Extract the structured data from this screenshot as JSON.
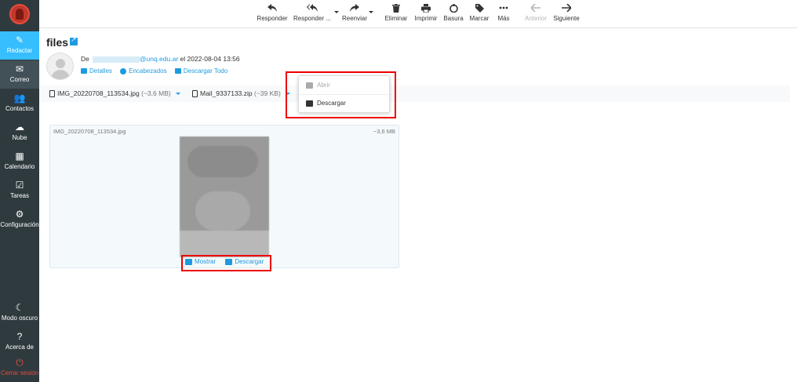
{
  "sidebar": {
    "items": [
      {
        "label": "Redactar",
        "icon": "compose-icon"
      },
      {
        "label": "Correo",
        "icon": "envelope-icon"
      },
      {
        "label": "Contactos",
        "icon": "contacts-icon"
      },
      {
        "label": "Nube",
        "icon": "cloud-icon"
      },
      {
        "label": "Calendario",
        "icon": "calendar-icon"
      },
      {
        "label": "Tareas",
        "icon": "tasks-icon"
      },
      {
        "label": "Configuración",
        "icon": "gear-icon"
      }
    ],
    "bottom": [
      {
        "label": "Modo oscuro",
        "icon": "moon-icon"
      },
      {
        "label": "Acerca de",
        "icon": "question-icon"
      },
      {
        "label": "Cerrar sesión",
        "icon": "power-icon"
      }
    ]
  },
  "toolbar": {
    "reply": "Responder",
    "reply_all": "Responder ...",
    "forward": "Reenviar",
    "delete": "Eliminar",
    "print": "Imprimir",
    "junk": "Basura",
    "mark": "Marcar",
    "more": "Más",
    "previous": "Anterior",
    "next": "Siguiente"
  },
  "message": {
    "subject": "files",
    "from_label": "De",
    "from_email": "@unq.edu.ar",
    "date_text": "el 2022-08-04 13:56",
    "links": {
      "details": "Detalles",
      "headers": "Encabezados",
      "download_all": "Descargar Todo"
    }
  },
  "attachments": [
    {
      "name": "IMG_20220708_113534.jpg",
      "size": "(~3,6 MB)"
    },
    {
      "name": "Mail_9337133.zip",
      "size": "(~39 KB)"
    }
  ],
  "popup": {
    "open": "Abrir",
    "download": "Descargar"
  },
  "preview": {
    "filename": "IMG_20220708_113534.jpg",
    "size": "~3,6 MB",
    "show": "Mostrar",
    "download": "Descargar"
  },
  "colors": {
    "accent": "#37beff",
    "link": "#1e9be0",
    "sidebar": "#2f3a3f",
    "highlight": "#ee0000"
  }
}
